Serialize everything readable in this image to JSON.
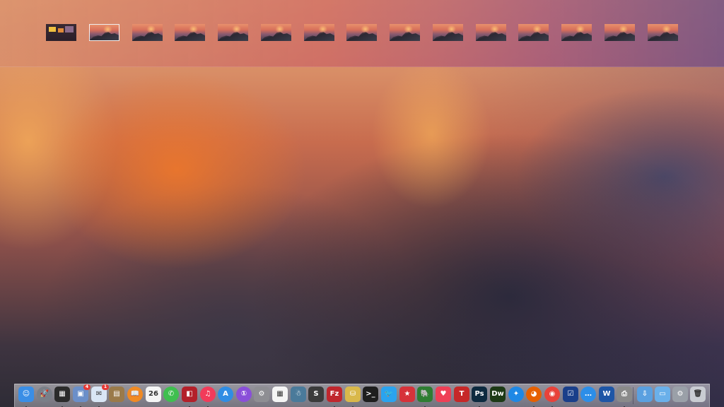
{
  "mission_control": {
    "spaces": [
      {
        "name": "dashboard-thumbnail",
        "kind": "dashboard"
      },
      {
        "name": "desktop-1-thumbnail",
        "kind": "desktop",
        "selected": true
      },
      {
        "name": "desktop-2-thumbnail",
        "kind": "desktop"
      },
      {
        "name": "desktop-3-thumbnail",
        "kind": "desktop"
      },
      {
        "name": "desktop-4-thumbnail",
        "kind": "desktop"
      },
      {
        "name": "desktop-5-thumbnail",
        "kind": "desktop"
      },
      {
        "name": "desktop-6-thumbnail",
        "kind": "desktop"
      },
      {
        "name": "desktop-7-thumbnail",
        "kind": "desktop"
      },
      {
        "name": "desktop-8-thumbnail",
        "kind": "desktop"
      },
      {
        "name": "desktop-9-thumbnail",
        "kind": "desktop"
      },
      {
        "name": "desktop-10-thumbnail",
        "kind": "desktop"
      },
      {
        "name": "desktop-11-thumbnail",
        "kind": "desktop"
      },
      {
        "name": "desktop-12-thumbnail",
        "kind": "desktop"
      },
      {
        "name": "desktop-13-thumbnail",
        "kind": "desktop"
      },
      {
        "name": "desktop-14-thumbnail",
        "kind": "desktop"
      }
    ]
  },
  "dock": {
    "apps": [
      {
        "name": "finder",
        "icon": "finder-icon",
        "color": "#3a8ee6",
        "glyph": "☺",
        "running": true
      },
      {
        "name": "launchpad",
        "icon": "rocket-icon",
        "color": "#7a7f88",
        "glyph": "🚀",
        "round": true
      },
      {
        "name": "dashboard",
        "icon": "dashboard-icon",
        "color": "#2b2b2b",
        "glyph": "▦",
        "running": true
      },
      {
        "name": "preview",
        "icon": "preview-icon",
        "color": "#6b8fc9",
        "glyph": "▣",
        "badge": "4",
        "running": true
      },
      {
        "name": "mail",
        "icon": "mail-icon",
        "color": "#d9e6f5",
        "glyph": "✉",
        "badge": "1",
        "running": true
      },
      {
        "name": "notes",
        "icon": "notebook-icon",
        "color": "#9a7a4a",
        "glyph": "▤"
      },
      {
        "name": "ibooks",
        "icon": "book-icon",
        "color": "#f08a24",
        "glyph": "📖",
        "round": true
      },
      {
        "name": "calendar",
        "icon": "calendar-icon",
        "color": "#f5f5f5",
        "text": "26"
      },
      {
        "name": "messages",
        "icon": "phone-icon",
        "color": "#3fbf4f",
        "glyph": "✆",
        "round": true
      },
      {
        "name": "photo-booth",
        "icon": "photo-icon",
        "color": "#b3202a",
        "glyph": "◧",
        "running": true
      },
      {
        "name": "itunes",
        "icon": "music-icon",
        "color": "#f23b5a",
        "glyph": "♫",
        "round": true,
        "running": true
      },
      {
        "name": "app-store",
        "icon": "app-store-icon",
        "color": "#2f8de4",
        "glyph": "A",
        "round": true
      },
      {
        "name": "1password",
        "icon": "key-icon",
        "color": "#8a4fd9",
        "glyph": "①",
        "round": true
      },
      {
        "name": "system-preferences",
        "icon": "gear-icon",
        "color": "#8e8e93",
        "glyph": "⚙"
      },
      {
        "name": "launch-grid",
        "icon": "grid-icon",
        "color": "#f5f5f5",
        "glyph": "▦"
      },
      {
        "name": "sprite-app",
        "icon": "person-icon",
        "color": "#4a7a9a",
        "glyph": "☃"
      },
      {
        "name": "sublime-text",
        "icon": "code-editor-icon",
        "color": "#3b3b3b",
        "glyph": "S"
      },
      {
        "name": "filezilla",
        "icon": "fz-icon",
        "color": "#c0262d",
        "text": "Fz",
        "running": true
      },
      {
        "name": "sequel-app",
        "icon": "database-icon",
        "color": "#d9b84a",
        "glyph": "⛁",
        "running": true
      },
      {
        "name": "terminal",
        "icon": "terminal-icon",
        "color": "#1e1e1e",
        "text": ">_"
      },
      {
        "name": "twitter",
        "icon": "bird-icon",
        "color": "#2aa3ef",
        "glyph": "🐦"
      },
      {
        "name": "wunderlist",
        "icon": "star-icon",
        "color": "#d6323a",
        "glyph": "★"
      },
      {
        "name": "evernote",
        "icon": "elephant-icon",
        "color": "#2e7d32",
        "glyph": "🐘",
        "running": true
      },
      {
        "name": "pocket",
        "icon": "pocket-icon",
        "color": "#ef3f56",
        "glyph": "♥"
      },
      {
        "name": "typeeto",
        "icon": "t-icon",
        "color": "#c62828",
        "text": "T"
      },
      {
        "name": "photoshop",
        "icon": "ps-icon",
        "color": "#0d2a3f",
        "text": "Ps",
        "running": true
      },
      {
        "name": "dreamweaver",
        "icon": "dw-icon",
        "color": "#1d3a16",
        "text": "Dw"
      },
      {
        "name": "safari",
        "icon": "compass-icon",
        "color": "#1e88e5",
        "glyph": "✦",
        "round": true
      },
      {
        "name": "firefox",
        "icon": "firefox-icon",
        "color": "#e66000",
        "glyph": "◕",
        "round": true,
        "running": true
      },
      {
        "name": "chrome",
        "icon": "chrome-icon",
        "color": "#e8423a",
        "glyph": "◉",
        "round": true,
        "running": true
      },
      {
        "name": "things",
        "icon": "checkbox-icon",
        "color": "#1a3f8a",
        "glyph": "☑"
      },
      {
        "name": "messages-bubble",
        "icon": "chat-icon",
        "color": "#2c8ee8",
        "glyph": "…",
        "round": true
      },
      {
        "name": "word",
        "icon": "word-icon",
        "color": "#1e56a6",
        "text": "W"
      },
      {
        "name": "printer",
        "icon": "printer-icon",
        "color": "#8a8a8a",
        "glyph": "⎙",
        "running": true
      },
      {
        "name": "downloads-stack",
        "icon": "downloads-icon",
        "color": "#5aa0e0",
        "glyph": "⇩"
      },
      {
        "name": "folder-stack",
        "icon": "folder-icon",
        "color": "#6ab0ea",
        "glyph": "▭"
      },
      {
        "name": "documents-stack",
        "icon": "documents-icon",
        "color": "#9aa0a8",
        "glyph": "⚙"
      },
      {
        "name": "trash",
        "icon": "trash-icon",
        "color": "#c9ccd2",
        "glyph": "🗑"
      }
    ]
  }
}
